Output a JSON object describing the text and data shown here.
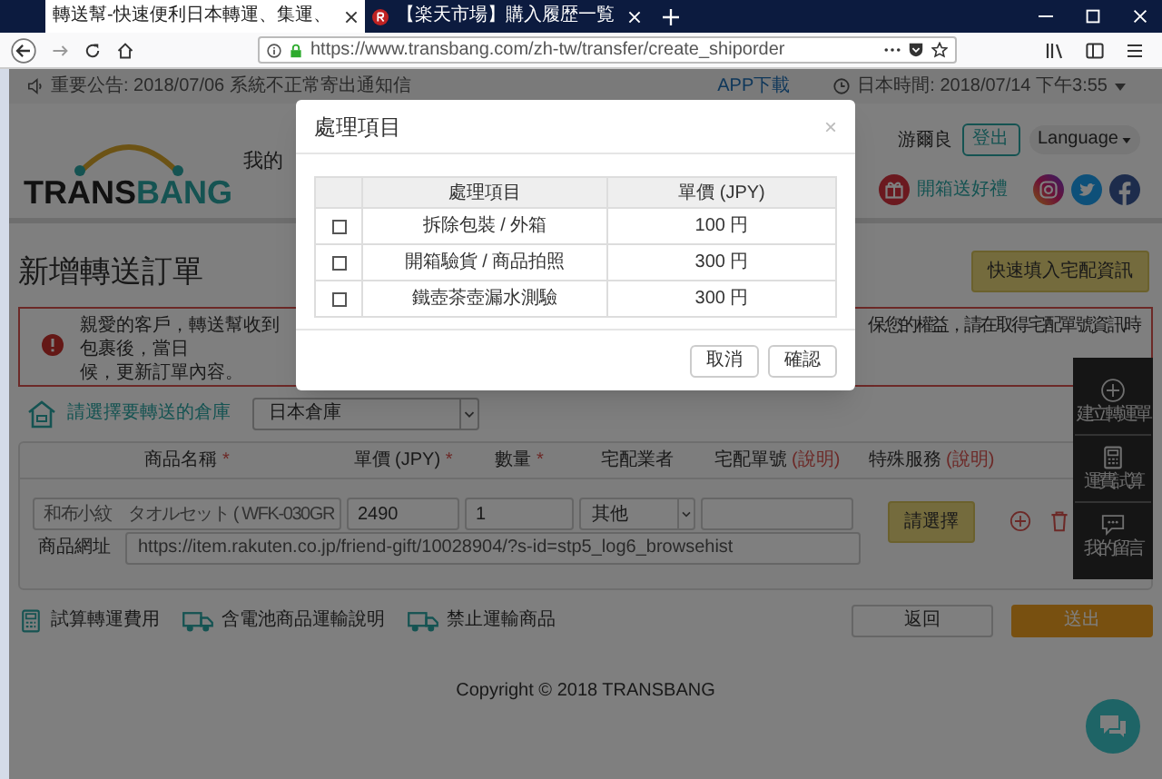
{
  "browser": {
    "tabs": [
      {
        "title": "轉送幫-快速便利日本轉運、集運、",
        "selected": true
      },
      {
        "title": "【楽天市場】購入履歴一覧",
        "selected": false
      }
    ],
    "url": "https://www.transbang.com/zh-tw/transfer/create_shiporder"
  },
  "top_bar": {
    "announcement": "重要公告: 2018/07/06 系統不正常寄出通知信",
    "app_download": "APP下載",
    "japan_time": "日本時間: 2018/07/14 下午3:55"
  },
  "header": {
    "logo": {
      "text_dark": "TRANS",
      "text_accent": "BANG"
    },
    "nav_partial": "我的",
    "user": "游爾良",
    "logout": "登出",
    "language": "Language",
    "promo": "開箱送好禮"
  },
  "page_title": "新增轉送訂單",
  "quick_fill": "快速填入宅配資訊",
  "notice": {
    "left_line": "親愛的客戶，轉送幫收到包裹後，當日",
    "right_line": "保您的權益，請在取得宅配單號資訊時",
    "last_line": "候，更新訂單內容。"
  },
  "warehouse": {
    "label": "請選擇要轉送的倉庫",
    "value": "日本倉庫"
  },
  "columns": [
    {
      "label": "商品名稱",
      "mark": "*"
    },
    {
      "label": "單價 (JPY)",
      "mark": "*"
    },
    {
      "label": "數量",
      "mark": "*"
    },
    {
      "label": "宅配業者"
    },
    {
      "label": "宅配單號",
      "help": "(說明)"
    },
    {
      "label": "特殊服務",
      "help": "(說明)"
    }
  ],
  "item": {
    "name": "和布小紋　タオルセット ( WFK-030GR",
    "price": "2490",
    "quantity": "1",
    "carrier": "其他",
    "service_button": "請選擇",
    "url_label": "商品網址",
    "url": "https://item.rakuten.co.jp/friend-gift/10028904/?s-id=stp5_log6_browsehist"
  },
  "links": [
    {
      "label": "試算轉運費用",
      "kind": "calculator"
    },
    {
      "label": "含電池商品運輸說明",
      "kind": "truck"
    },
    {
      "label": "禁止運輸商品",
      "kind": "truck"
    }
  ],
  "back_button": "返回",
  "submit_button": "送出",
  "copyright": "Copyright © 2018 TRANSBANG",
  "side_panel": [
    {
      "label": "建立轉運單",
      "kind": "plus"
    },
    {
      "label": "運費試算",
      "kind": "calculator"
    },
    {
      "label": "我的留言",
      "kind": "chat"
    }
  ],
  "modal": {
    "title": "處理項目",
    "close": "×",
    "columns": [
      "處理項目",
      "單價 (JPY)"
    ],
    "rows": [
      {
        "item": "拆除包裝 / 外箱",
        "price": "100 円",
        "checked": false
      },
      {
        "item": "開箱驗貨 / 商品拍照",
        "price": "300 円",
        "checked": false
      },
      {
        "item": "鐵壺茶壺漏水測驗",
        "price": "300 円",
        "checked": false
      }
    ],
    "buttons": [
      "取消",
      "確認"
    ]
  }
}
